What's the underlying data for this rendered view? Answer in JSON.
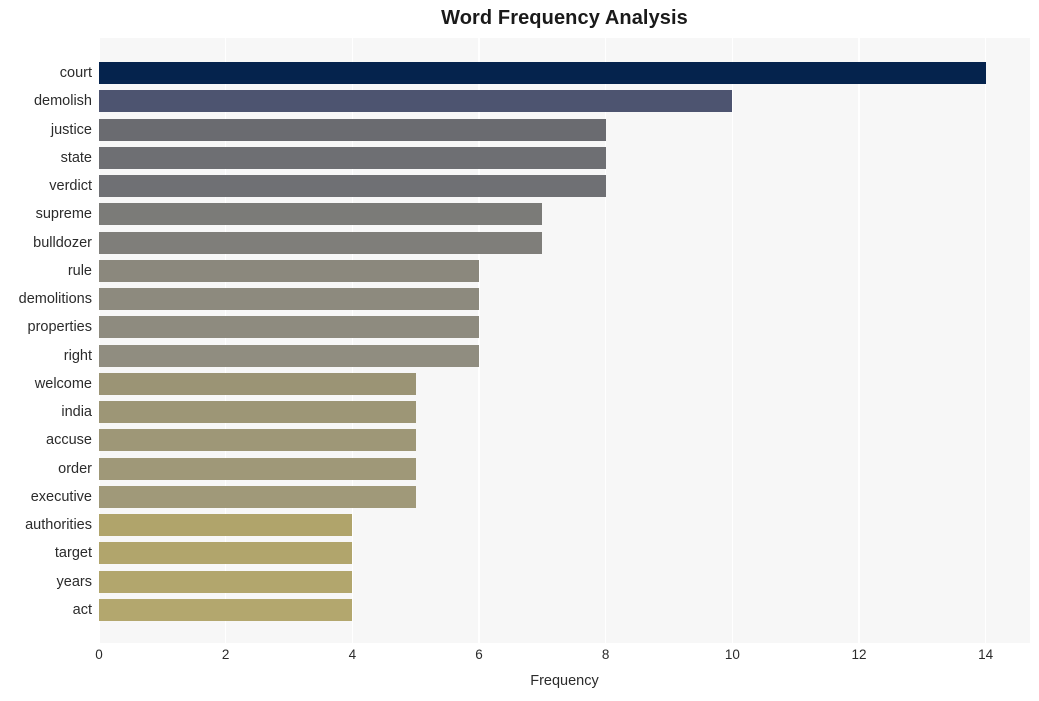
{
  "chart_data": {
    "type": "bar",
    "orientation": "horizontal",
    "title": "Word Frequency Analysis",
    "xlabel": "Frequency",
    "ylabel": "",
    "categories": [
      "court",
      "demolish",
      "justice",
      "state",
      "verdict",
      "supreme",
      "bulldozer",
      "rule",
      "demolitions",
      "properties",
      "right",
      "welcome",
      "india",
      "accuse",
      "order",
      "executive",
      "authorities",
      "target",
      "years",
      "act"
    ],
    "values": [
      14,
      10,
      8,
      8,
      8,
      7,
      7,
      6,
      6,
      6,
      6,
      5,
      5,
      5,
      5,
      5,
      4,
      4,
      4,
      4
    ],
    "bar_colors": [
      "#05234d",
      "#4d5470",
      "#6a6b70",
      "#6e6f73",
      "#6f7074",
      "#7b7b78",
      "#7f7e7a",
      "#8b887d",
      "#8d8a7e",
      "#8e8b7f",
      "#908d80",
      "#9b9475",
      "#9d9676",
      "#9e9777",
      "#9f9878",
      "#a09979",
      "#b0a46b",
      "#b1a56c",
      "#b2a66d",
      "#b3a76e"
    ],
    "xlim": [
      0,
      14.7
    ],
    "xticks": [
      0,
      2,
      4,
      6,
      8,
      10,
      12,
      14
    ],
    "xtick_labels": [
      "0",
      "2",
      "4",
      "6",
      "8",
      "10",
      "12",
      "14"
    ],
    "grid": true,
    "grid_color": "#ffffff",
    "plot_background": "#f7f7f7",
    "figure_background": "#ffffff",
    "legend": null
  }
}
